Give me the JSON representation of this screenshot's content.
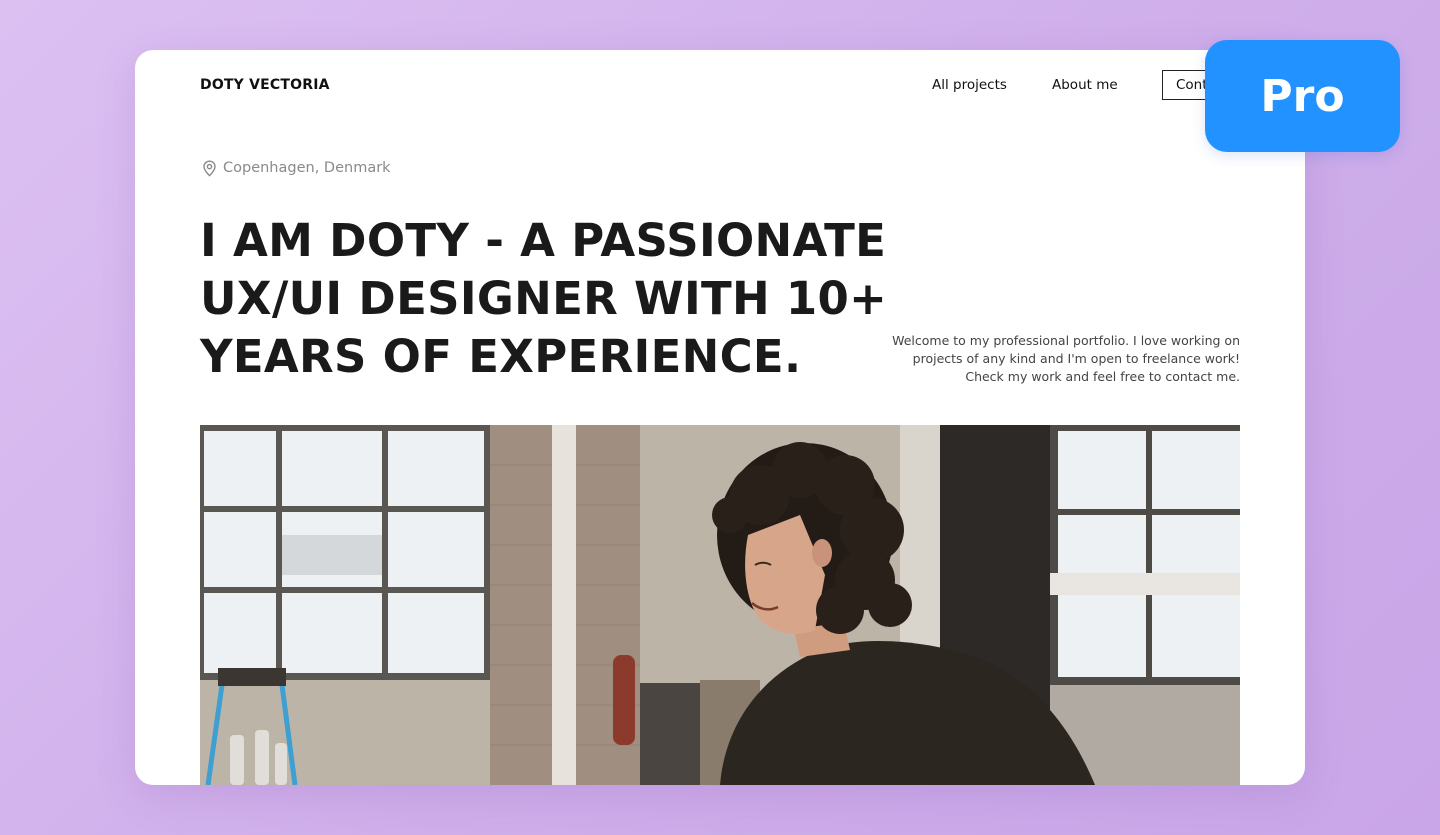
{
  "nav": {
    "brand": "DOTY VECTORIA",
    "links": [
      "All projects",
      "About me"
    ],
    "contact_label": "Contact me"
  },
  "hero": {
    "location_icon": "map-pin-icon",
    "location": "Copenhagen, Denmark",
    "headline_lines": [
      "I AM DOTY - A PASSIONATE",
      "UX/UI DESIGNER WITH 10+",
      "YEARS OF EXPERIENCE."
    ],
    "intro_lines": [
      "Welcome to my professional portfolio. I love working on",
      "projects of any kind and I'm open to freelance work!",
      "Check my work and feel free to contact me."
    ]
  },
  "badge": {
    "label": "Pro",
    "color": "#2192ff"
  },
  "colors": {
    "background": "#d6b8ee",
    "card": "#ffffff",
    "text": "#1a1a1a",
    "muted": "#8a8a8a"
  }
}
